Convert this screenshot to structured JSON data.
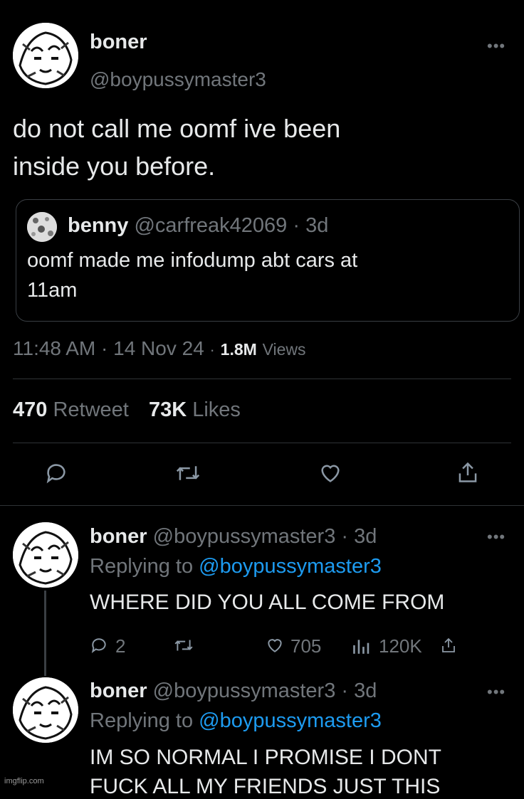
{
  "main_tweet": {
    "display_name": "boner",
    "handle": "@boypussymaster3",
    "text_line1": "do not call me oomf ive been",
    "text_line2": "inside you before.",
    "more_icon": "more-dots-icon"
  },
  "quoted_tweet": {
    "display_name": "benny",
    "handle": "@carfreak42069",
    "age": "3d",
    "text_line1": "oomf made me infodump abt cars at",
    "text_line2": "11am"
  },
  "meta": {
    "time": "11:48 AM",
    "date": "14 Nov 24",
    "views_count": "1.8M",
    "views_label": "Views",
    "separator": "·"
  },
  "stats": {
    "retweets_count": "470",
    "retweets_label": "Retweet",
    "likes_count": "73K",
    "likes_label": "Likes"
  },
  "actions": [
    "reply-icon",
    "retweet-icon",
    "like-icon",
    "share-icon"
  ],
  "replies": [
    {
      "display_name": "boner",
      "handle": "@boypussymaster3",
      "age": "3d",
      "replying_prefix": "Replying to",
      "replying_to": "@boypussymaster3",
      "text_line1": "WHERE DID YOU ALL COME FROM",
      "reply_count": "2",
      "like_count": "705",
      "view_count": "120K"
    },
    {
      "display_name": "boner",
      "handle": "@boypussymaster3",
      "age": "3d",
      "replying_prefix": "Replying to",
      "replying_to": "@boypussymaster3",
      "text_line1": "IM SO NORMAL I PROMISE I DONT",
      "text_line2": "FUCK ALL MY FRIENDS JUST THIS"
    }
  ],
  "watermark": "imgflip.com",
  "colors": {
    "background": "#000000",
    "text": "#e7e9ea",
    "muted": "#71767b",
    "link": "#1d9bf0",
    "divider": "#2f3336"
  }
}
